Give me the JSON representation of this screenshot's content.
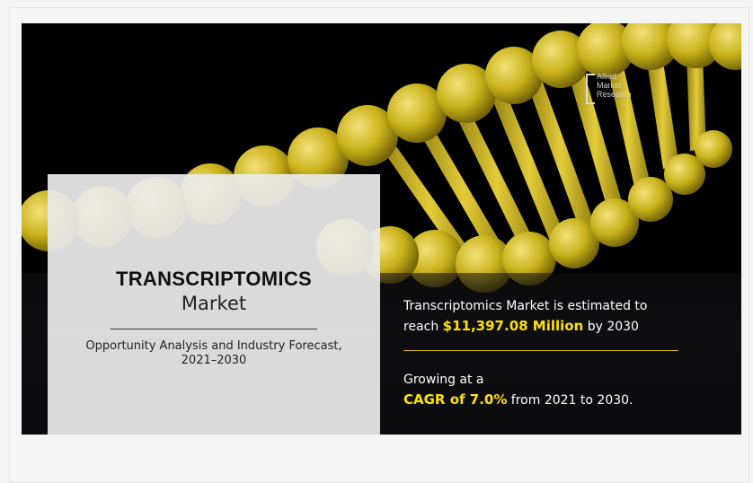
{
  "logo": {
    "lines": [
      "Allied",
      "Market",
      "Research"
    ]
  },
  "panel": {
    "title": "TRANSCRIPTOMICS",
    "subtitle": "Market",
    "description_line1": "Opportunity Analysis and Industry Forecast,",
    "description_line2": "2021–2030"
  },
  "stats": {
    "market_line1": "Transcriptomics Market is estimated to",
    "market_prefix": "reach ",
    "market_value": "$11,397.08 Million",
    "market_suffix": " by 2030",
    "growth_line1": "Growing at a",
    "growth_value": "CAGR of 7.0%",
    "growth_suffix": " from 2021 to 2030."
  },
  "colors": {
    "highlight": "#ffe100",
    "helix_gold": "#c9b21a",
    "background": "#000000"
  }
}
